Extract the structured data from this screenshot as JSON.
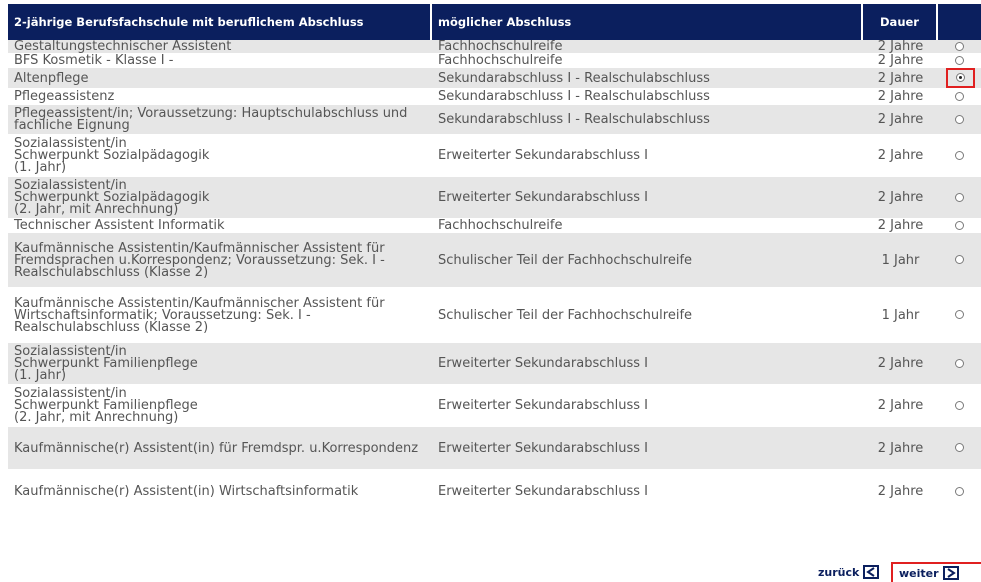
{
  "table": {
    "headers": {
      "course": "2-jährige Berufsfachschule mit beruflichem Abschluss",
      "degree": "möglicher Abschluss",
      "duration": "Dauer",
      "select": ""
    },
    "rows": [
      {
        "course": "Gestaltungstechnischer Assistent",
        "degree": "Fachhochschulreife",
        "duration": "2 Jahre",
        "selected": false
      },
      {
        "course": "BFS Kosmetik - Klasse I -",
        "degree": "Fachhochschulreife",
        "duration": "2 Jahre",
        "selected": false
      },
      {
        "course": "Altenpflege",
        "degree": "Sekundarabschluss I - Realschulabschluss",
        "duration": "2 Jahre",
        "selected": true
      },
      {
        "course": "Pflegeassistenz",
        "degree": "Sekundarabschluss I - Realschulabschluss",
        "duration": "2 Jahre",
        "selected": false
      },
      {
        "course": "Pflegeassistent/in; Voraussetzung: Hauptschulabschluss und fachliche Eignung",
        "degree": "Sekundarabschluss I - Realschulabschluss",
        "duration": "2 Jahre",
        "selected": false
      },
      {
        "course": "Sozialassistent/in\nSchwerpunkt Sozialpädagogik\n(1. Jahr)",
        "degree": "Erweiterter Sekundarabschluss I",
        "duration": "2 Jahre",
        "selected": false
      },
      {
        "course": "Sozialassistent/in\nSchwerpunkt Sozialpädagogik\n(2. Jahr, mit Anrechnung)",
        "degree": "Erweiterter Sekundarabschluss I",
        "duration": "2 Jahre",
        "selected": false
      },
      {
        "course": "Technischer Assistent Informatik",
        "degree": "Fachhochschulreife",
        "duration": "2 Jahre",
        "selected": false
      },
      {
        "course": "Kaufmännische Assistentin/Kaufmännischer Assistent für Fremdsprachen u.Korrespondenz; Voraussetzung: Sek. I - Realschulabschluss (Klasse 2)",
        "degree": "Schulischer Teil der Fachhochschulreife",
        "duration": "1 Jahr",
        "selected": false
      },
      {
        "course": "Kaufmännische Assistentin/Kaufmännischer Assistent für Wirtschaftsinformatik; Voraussetzung: Sek. I - Realschulabschluss (Klasse 2)",
        "degree": "Schulischer Teil der Fachhochschulreife",
        "duration": "1 Jahr",
        "selected": false
      },
      {
        "course": "Sozialassistent/in\nSchwerpunkt Familienpflege\n(1. Jahr)",
        "degree": "Erweiterter Sekundarabschluss I",
        "duration": "2 Jahre",
        "selected": false
      },
      {
        "course": "Sozialassistent/in\nSchwerpunkt Familienpflege\n(2. Jahr, mit Anrechnung)",
        "degree": "Erweiterter Sekundarabschluss I",
        "duration": "2 Jahre",
        "selected": false
      },
      {
        "course": "Kaufmännische(r) Assistent(in) für Fremdspr. u.Korrespondenz",
        "degree": "Erweiterter Sekundarabschluss I",
        "duration": "2 Jahre",
        "selected": false
      },
      {
        "course": "Kaufmännische(r) Assistent(in) Wirtschaftsinformatik",
        "degree": "Erweiterter Sekundarabschluss I",
        "duration": "2 Jahre",
        "selected": false
      }
    ]
  },
  "nav": {
    "back_label": "zurück",
    "next_label": "weiter",
    "back_icon": "arrow-left-boxed-icon",
    "next_icon": "arrow-right-boxed-icon"
  },
  "colors": {
    "header_bg": "#0b1f5e",
    "row_alt_bg": "#e6e6e6",
    "highlight": "#e02020"
  }
}
